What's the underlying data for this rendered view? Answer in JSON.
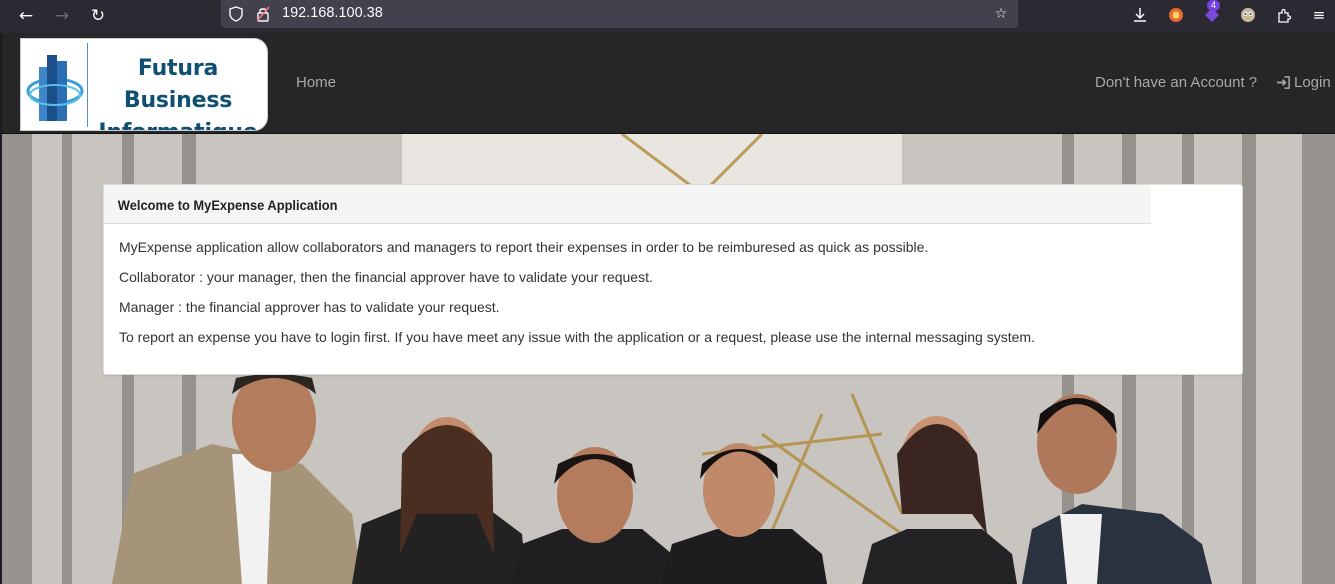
{
  "browser": {
    "url": "192.168.100.38",
    "extension_badge": "4"
  },
  "brand": {
    "line1": "Futura Business",
    "line2": "Informatique"
  },
  "nav": {
    "home": "Home",
    "signup": "Don't have an Account ?",
    "login": "Login"
  },
  "panel": {
    "title": "Welcome to MyExpense Application",
    "paragraphs": [
      "MyExpense application allow collaborators and managers to report their expenses in order to be reimburesed as quick as possible.",
      "Collaborator : your manager, then the financial approver have to validate your request.",
      "Manager : the financial approver has to validate your request.",
      "To report an expense you have to login first. If you have meet any issue with the application or a request, please use the internal messaging system."
    ]
  },
  "colors": {
    "navbar_bg": "#262629",
    "nav_link": "#a9a9a9",
    "brand_text": "#0f4f72",
    "panel_heading_bg": "#f5f5f5"
  },
  "icons": [
    "back-arrow-icon",
    "forward-arrow-icon",
    "reload-icon",
    "shield-icon",
    "lock-warning-icon",
    "bookmark-star-icon",
    "download-icon",
    "extension-icon",
    "menu-icon",
    "login-icon",
    "building-logo-icon"
  ]
}
